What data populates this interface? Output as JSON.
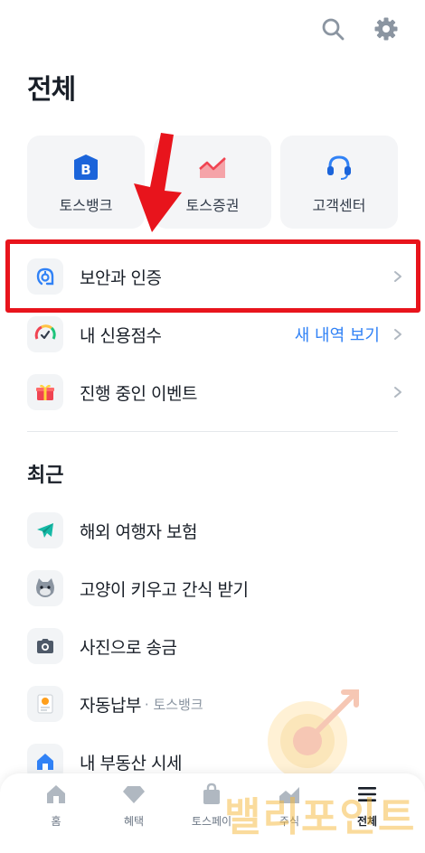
{
  "header": {
    "search_icon": "search-icon",
    "settings_icon": "gear-icon"
  },
  "page": {
    "title": "전체"
  },
  "quick_links": [
    {
      "label": "토스뱅크",
      "icon": "toss-bank-icon"
    },
    {
      "label": "토스증권",
      "icon": "toss-securities-icon"
    },
    {
      "label": "고객센터",
      "icon": "headset-icon"
    }
  ],
  "menu": [
    {
      "label": "보안과 인증",
      "icon": "security-icon"
    },
    {
      "label": "내 신용점수",
      "link": "새 내역 보기",
      "icon": "credit-gauge-icon"
    },
    {
      "label": "진행 중인 이벤트",
      "icon": "gift-icon"
    }
  ],
  "recent": {
    "title": "최근",
    "items": [
      {
        "label": "해외 여행자 보험",
        "icon": "airplane-icon"
      },
      {
        "label": "고양이 키우고 간식 받기",
        "icon": "cat-icon"
      },
      {
        "label": "사진으로 송금",
        "icon": "camera-icon"
      },
      {
        "label": "자동납부",
        "sub": "· 토스뱅크",
        "icon": "bill-icon"
      },
      {
        "label": "내 부동산 시세",
        "icon": "house-icon"
      }
    ]
  },
  "bottom_nav": [
    {
      "label": "홈",
      "icon": "home-icon"
    },
    {
      "label": "혜택",
      "icon": "diamond-icon"
    },
    {
      "label": "토스페이",
      "icon": "shopping-bag-icon"
    },
    {
      "label": "주식",
      "icon": "stock-chart-icon"
    },
    {
      "label": "전체",
      "icon": "menu-icon",
      "active": true
    }
  ],
  "watermark": {
    "text": "밸리포인트"
  },
  "colors": {
    "accent": "#3182f6",
    "highlight": "#e8141c",
    "card_bg": "#f4f5f7"
  }
}
